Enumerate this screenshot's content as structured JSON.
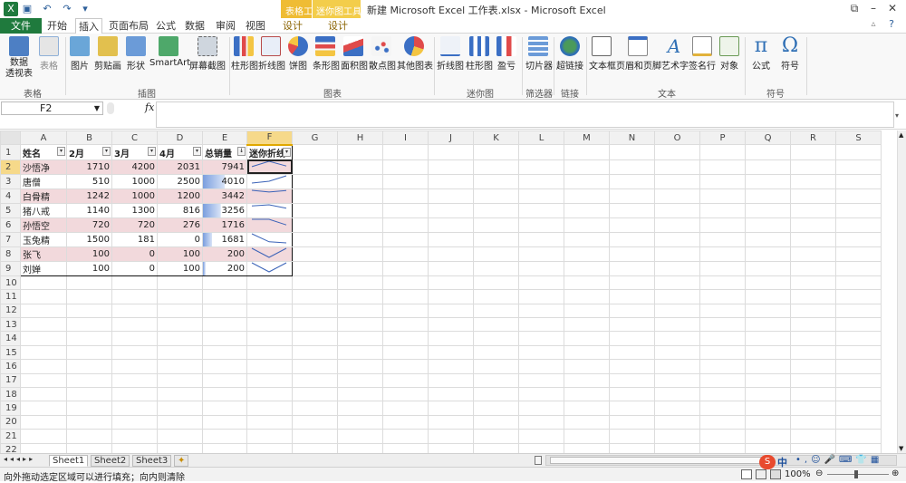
{
  "window": {
    "title": "新建 Microsoft Excel 工作表.xlsx - Microsoft Excel",
    "context_tabs": [
      "表格工具",
      "迷你图工具"
    ]
  },
  "tabs": [
    "文件",
    "开始",
    "插入",
    "页面布局",
    "公式",
    "数据",
    "审阅",
    "视图",
    "设计",
    "设计"
  ],
  "ribbon": {
    "buttons": [
      {
        "label": "数据\n透视表",
        "icon": "pivot-table-icon"
      },
      {
        "label": "表格",
        "icon": "table-icon"
      },
      {
        "label": "图片",
        "icon": "picture-icon"
      },
      {
        "label": "剪贴画",
        "icon": "clipart-icon"
      },
      {
        "label": "形状",
        "icon": "shapes-icon"
      },
      {
        "label": "SmartArt",
        "icon": "smartart-icon"
      },
      {
        "label": "屏幕截图",
        "icon": "screenshot-icon"
      },
      {
        "label": "柱形图",
        "icon": "column-chart-icon"
      },
      {
        "label": "折线图",
        "icon": "line-chart-icon"
      },
      {
        "label": "饼图",
        "icon": "pie-chart-icon"
      },
      {
        "label": "条形图",
        "icon": "bar-chart-icon"
      },
      {
        "label": "面积图",
        "icon": "area-chart-icon"
      },
      {
        "label": "散点图",
        "icon": "scatter-chart-icon"
      },
      {
        "label": "其他图表",
        "icon": "other-chart-icon"
      },
      {
        "label": "折线图",
        "icon": "sparkline-line-icon"
      },
      {
        "label": "柱形图",
        "icon": "sparkline-column-icon"
      },
      {
        "label": "盈亏",
        "icon": "sparkline-winloss-icon"
      },
      {
        "label": "切片器",
        "icon": "slicer-icon"
      },
      {
        "label": "超链接",
        "icon": "hyperlink-icon"
      },
      {
        "label": "文本框",
        "icon": "textbox-icon"
      },
      {
        "label": "页眉和页脚",
        "icon": "header-footer-icon"
      },
      {
        "label": "艺术字",
        "icon": "wordart-icon"
      },
      {
        "label": "签名行",
        "icon": "signature-icon"
      },
      {
        "label": "对象",
        "icon": "object-icon"
      },
      {
        "label": "公式",
        "icon": "equation-icon"
      },
      {
        "label": "符号",
        "icon": "symbol-icon"
      }
    ],
    "groups": [
      "表格",
      "插图",
      "图表",
      "迷你图",
      "筛选器",
      "链接",
      "文本",
      "符号"
    ]
  },
  "formula_bar": {
    "name_box": "F2",
    "fx": "fx",
    "content": ""
  },
  "columns": [
    "A",
    "B",
    "C",
    "D",
    "E",
    "F",
    "G",
    "H",
    "I",
    "J",
    "K",
    "L",
    "M",
    "N",
    "O",
    "P",
    "Q",
    "R",
    "S"
  ],
  "row_numbers": [
    "1",
    "2",
    "3",
    "4",
    "5",
    "6",
    "7",
    "8",
    "9",
    "10",
    "11",
    "12",
    "13",
    "14",
    "15",
    "16",
    "17",
    "18",
    "19",
    "20",
    "21",
    "22"
  ],
  "table": {
    "headers": [
      "姓名",
      "2月",
      "3月",
      "4月",
      "总销量",
      "迷你折线"
    ],
    "rows": [
      {
        "name": "沙悟净",
        "feb": "1710",
        "mar": "4200",
        "apr": "2031",
        "total": "7941",
        "bar": 1.0,
        "spark": [
          1710,
          4200,
          2031
        ]
      },
      {
        "name": "唐僧",
        "feb": "510",
        "mar": "1000",
        "apr": "2500",
        "total": "4010",
        "bar": 0.505,
        "spark": [
          510,
          1000,
          2500
        ]
      },
      {
        "name": "白骨精",
        "feb": "1242",
        "mar": "1000",
        "apr": "1200",
        "total": "3442",
        "bar": 0.433,
        "spark": [
          1242,
          1000,
          1200
        ]
      },
      {
        "name": "猪八戒",
        "feb": "1140",
        "mar": "1300",
        "apr": "816",
        "total": "3256",
        "bar": 0.41,
        "spark": [
          1140,
          1300,
          816
        ]
      },
      {
        "name": "孙悟空",
        "feb": "720",
        "mar": "720",
        "apr": "276",
        "total": "1716",
        "bar": 0.216,
        "spark": [
          720,
          720,
          276
        ]
      },
      {
        "name": "玉兔精",
        "feb": "1500",
        "mar": "181",
        "apr": "0",
        "total": "1681",
        "bar": 0.212,
        "spark": [
          1500,
          181,
          0
        ]
      },
      {
        "name": "张飞",
        "feb": "100",
        "mar": "0",
        "apr": "100",
        "total": "200",
        "bar": 0.025,
        "spark": [
          100,
          0,
          100
        ]
      },
      {
        "name": "刘婵",
        "feb": "100",
        "mar": "0",
        "apr": "100",
        "total": "200",
        "bar": 0.025,
        "spark": [
          100,
          0,
          100
        ]
      }
    ]
  },
  "sheets": [
    "Sheet1",
    "Sheet2",
    "Sheet3"
  ],
  "status": {
    "text": "向外拖动选定区域可以进行填充；向内则清除",
    "zoom": "100%",
    "ime": "中"
  },
  "colors": {
    "file_tab": "#1f7a3d",
    "context_tab": "#efbc34",
    "pink_row": "#f2d9dc",
    "databar": "#7a9ede",
    "spark": "#3b63b8"
  }
}
